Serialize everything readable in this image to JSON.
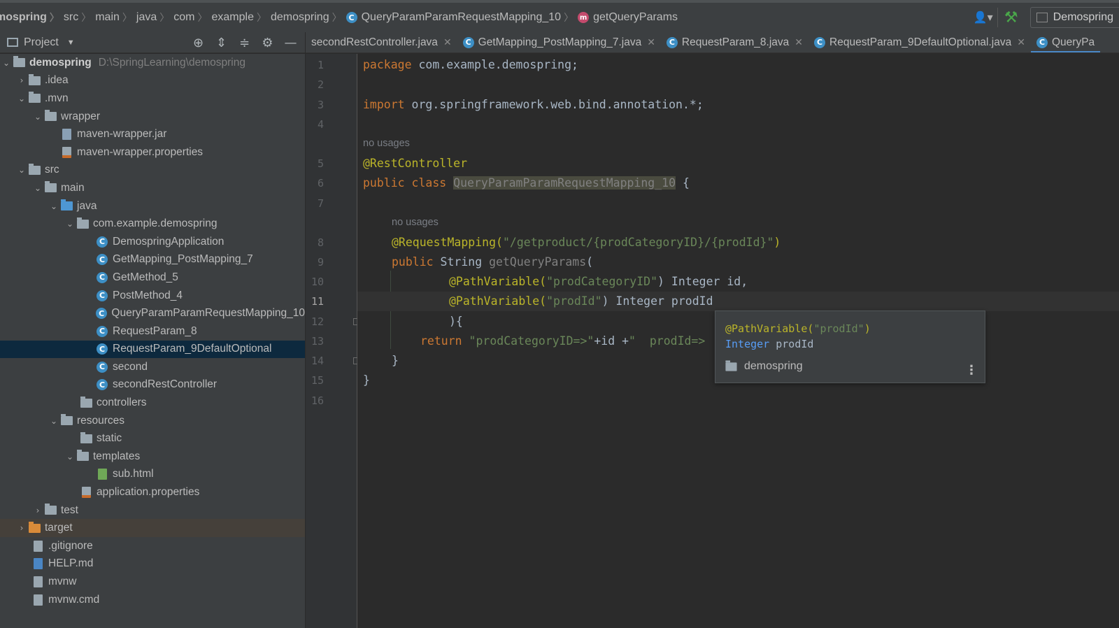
{
  "breadcrumb": {
    "items": [
      "mospring",
      "src",
      "main",
      "java",
      "com",
      "example",
      "demospring",
      "QueryParamParamRequestMapping_10",
      "getQueryParams"
    ]
  },
  "toolbar": {
    "run_config": "Demospring"
  },
  "project_panel": {
    "title": "Project",
    "root_name": "demospring",
    "root_path": "D:\\SpringLearning\\demospring",
    "tree": [
      {
        "label": ".idea"
      },
      {
        "label": ".mvn"
      },
      {
        "label": "wrapper"
      },
      {
        "label": "maven-wrapper.jar"
      },
      {
        "label": "maven-wrapper.properties"
      },
      {
        "label": "src"
      },
      {
        "label": "main"
      },
      {
        "label": "java"
      },
      {
        "label": "com.example.demospring"
      },
      {
        "label": "DemospringApplication"
      },
      {
        "label": "GetMapping_PostMapping_7"
      },
      {
        "label": "GetMethod_5"
      },
      {
        "label": "PostMethod_4"
      },
      {
        "label": "QueryParamParamRequestMapping_10"
      },
      {
        "label": "RequestParam_8"
      },
      {
        "label": "RequestParam_9DefaultOptional"
      },
      {
        "label": "second"
      },
      {
        "label": "secondRestController"
      },
      {
        "label": "controllers"
      },
      {
        "label": "resources"
      },
      {
        "label": "static"
      },
      {
        "label": "templates"
      },
      {
        "label": "sub.html"
      },
      {
        "label": "application.properties"
      },
      {
        "label": "test"
      },
      {
        "label": "target"
      },
      {
        "label": ".gitignore"
      },
      {
        "label": "HELP.md"
      },
      {
        "label": "mvnw"
      },
      {
        "label": "mvnw.cmd"
      }
    ]
  },
  "tabs": [
    {
      "label": "secondRestController.java"
    },
    {
      "label": "GetMapping_PostMapping_7.java"
    },
    {
      "label": "RequestParam_8.java"
    },
    {
      "label": "RequestParam_9DefaultOptional.java"
    },
    {
      "label": "QueryPa"
    }
  ],
  "editor": {
    "line_numbers": [
      "1",
      "2",
      "3",
      "4",
      "5",
      "6",
      "7",
      "8",
      "9",
      "10",
      "11",
      "12",
      "13",
      "14",
      "15",
      "16"
    ],
    "usage_hint": "no usages",
    "code": {
      "l1_kw": "package",
      "l1_rest": " com.example.demospring;",
      "l3_kw": "import",
      "l3_rest": " org.springframework.web.bind.annotation.*;",
      "l5_ann": "@RestController",
      "l6_kw": "public class",
      "l6_cls": "QueryParamParamRequestMapping_10",
      "l6_rest": " {",
      "l8_ann": "@RequestMapping(",
      "l8_str": "\"/getproduct/{prodCategoryID}/{prodId}\"",
      "l8_end": ")",
      "l9_kw": "public",
      "l9_type": " String ",
      "l9_name": "getQueryParams",
      "l9_end": "(",
      "l10_ann": "@PathVariable(",
      "l10_str": "\"prodCategoryID\"",
      "l10_rest": ") Integer id,",
      "l11_ann": "@PathVariable(",
      "l11_str": "\"prodId\"",
      "l11_rest": ") Integer prodId",
      "l12": "){",
      "l13_kw": "return",
      "l13_str1": " \"prodCategoryID=>\"",
      "l13_mid": "+id +",
      "l13_str2": "\"  prodId=>",
      "l14": "}",
      "l15": "}"
    }
  },
  "popup": {
    "line1_ann": "@PathVariable(",
    "line1_str": "\"prodId\"",
    "line1_end": ")",
    "line2_type": "Integer",
    "line2_name": " prodId",
    "package": "demospring"
  }
}
